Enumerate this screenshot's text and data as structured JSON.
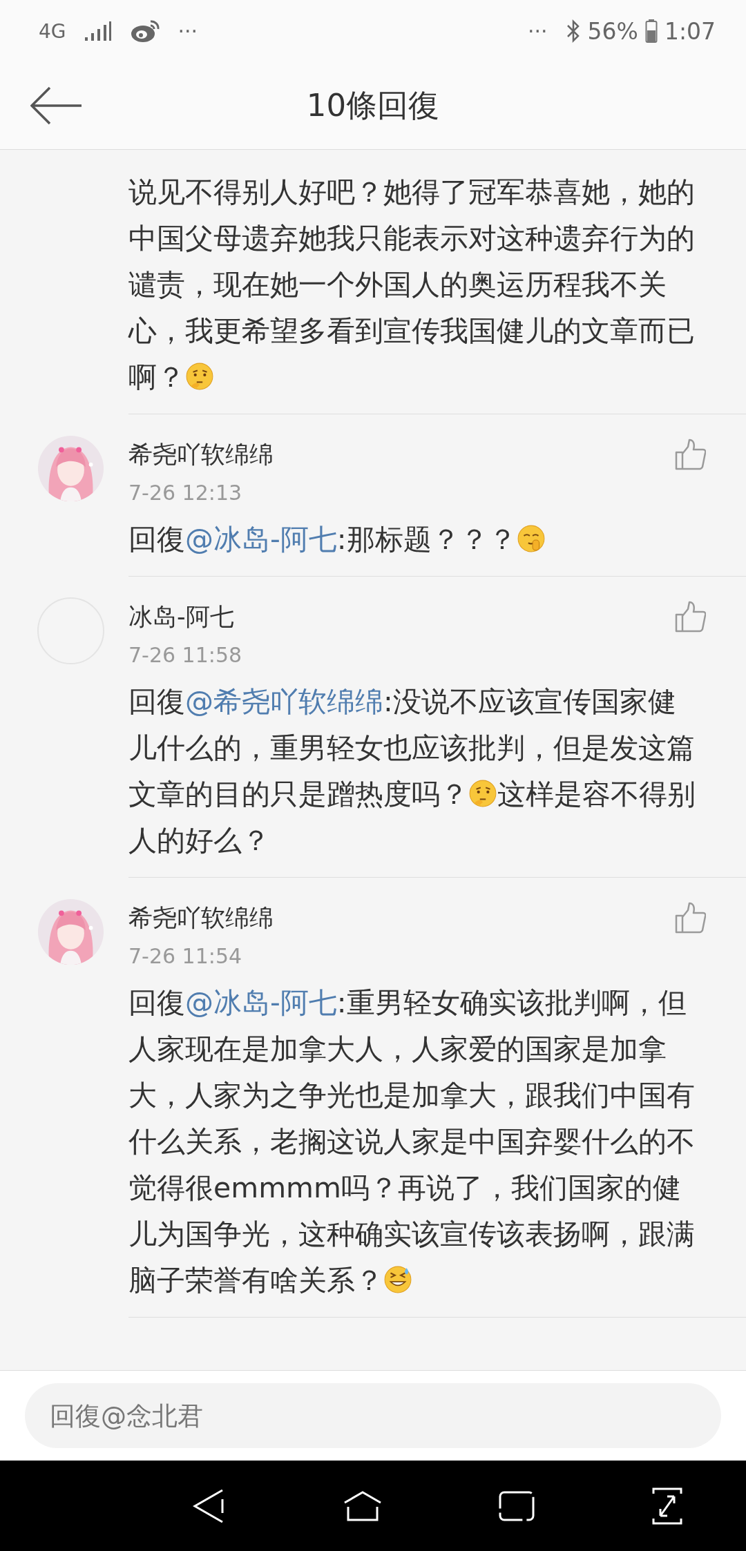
{
  "status_bar": {
    "network": "4G",
    "left_more": "···",
    "right_more": "···",
    "battery": "56%",
    "time": "1:07"
  },
  "header": {
    "title": "10條回復"
  },
  "comments": [
    {
      "parts": [
        {
          "kind": "text",
          "text": "说见不得别人好吧？她得了冠军恭喜她，她的中国父母遗弃她我只能表示对这种遗弃行为的谴责，现在她一个外国人的奥运历程我不关心，我更希望多看到宣传我国健儿的文章而已啊？"
        },
        {
          "kind": "thinking"
        }
      ]
    },
    {
      "avatar": {
        "kind": "picture"
      },
      "name": "希尧吖软绵绵",
      "time": "7-26 12:13",
      "parts": [
        {
          "kind": "text",
          "text": "回復"
        },
        {
          "kind": "mention",
          "text": "@冰岛-阿七"
        },
        {
          "kind": "text",
          "text": ":那标题？？？"
        },
        {
          "kind": "shush"
        }
      ]
    },
    {
      "avatar": {
        "kind": "blank"
      },
      "name": "冰岛-阿七",
      "time": "7-26 11:58",
      "parts": [
        {
          "kind": "text",
          "text": "回復"
        },
        {
          "kind": "mention",
          "text": "@希尧吖软绵绵"
        },
        {
          "kind": "text",
          "text": ":没说不应该宣传国家健儿什么的，重男轻女也应该批判，但是发这篇文章的目的只是蹭热度吗？"
        },
        {
          "kind": "thinking"
        },
        {
          "kind": "text",
          "text": "这样是容不得别人的好么？"
        }
      ]
    },
    {
      "avatar": {
        "kind": "picture"
      },
      "name": "希尧吖软绵绵",
      "time": "7-26 11:54",
      "parts": [
        {
          "kind": "text",
          "text": "回復"
        },
        {
          "kind": "mention",
          "text": "@冰岛-阿七"
        },
        {
          "kind": "text",
          "text": ":重男轻女确实该批判啊，但人家现在是加拿大人，人家爱的国家是加拿大，人家为之争光也是加拿大，跟我们中国有什么关系，老搁这说人家是中国弃婴什么的不觉得很emmmm吗？再说了，我们国家的健儿为国争光，这种确实该宣传该表扬啊，跟满脑子荣誉有啥关系？"
        },
        {
          "kind": "sweat"
        }
      ]
    }
  ],
  "reply_box": {
    "placeholder": "回復@念北君"
  }
}
